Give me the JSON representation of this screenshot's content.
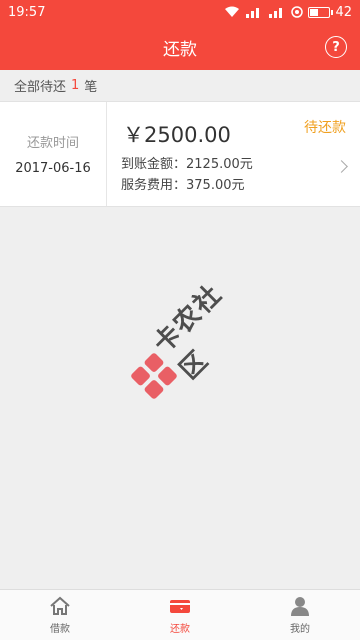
{
  "status_bar": {
    "time": "19:57",
    "battery_level": "42",
    "icons": [
      "wifi-icon",
      "signal-icon",
      "signal-icon",
      "notification-icon",
      "battery-icon"
    ]
  },
  "header": {
    "title": "还款",
    "help_label": "?"
  },
  "summary": {
    "prefix": "全部待还",
    "count": "1",
    "suffix": "笔"
  },
  "repayment": {
    "time_label": "还款时间",
    "date": "2017-06-16",
    "amount": "￥2500.00",
    "status": "待还款",
    "received_line": "到账金额：2125.00元",
    "fee_line": "服务费用：375.00元"
  },
  "watermark": {
    "text": "卡农社区"
  },
  "tabs": [
    {
      "label": "借款",
      "icon": "home-icon"
    },
    {
      "label": "还款",
      "icon": "wallet-icon"
    },
    {
      "label": "我的",
      "icon": "user-icon"
    }
  ],
  "colors": {
    "brand": "#f4483c",
    "pending": "#f0a020"
  }
}
